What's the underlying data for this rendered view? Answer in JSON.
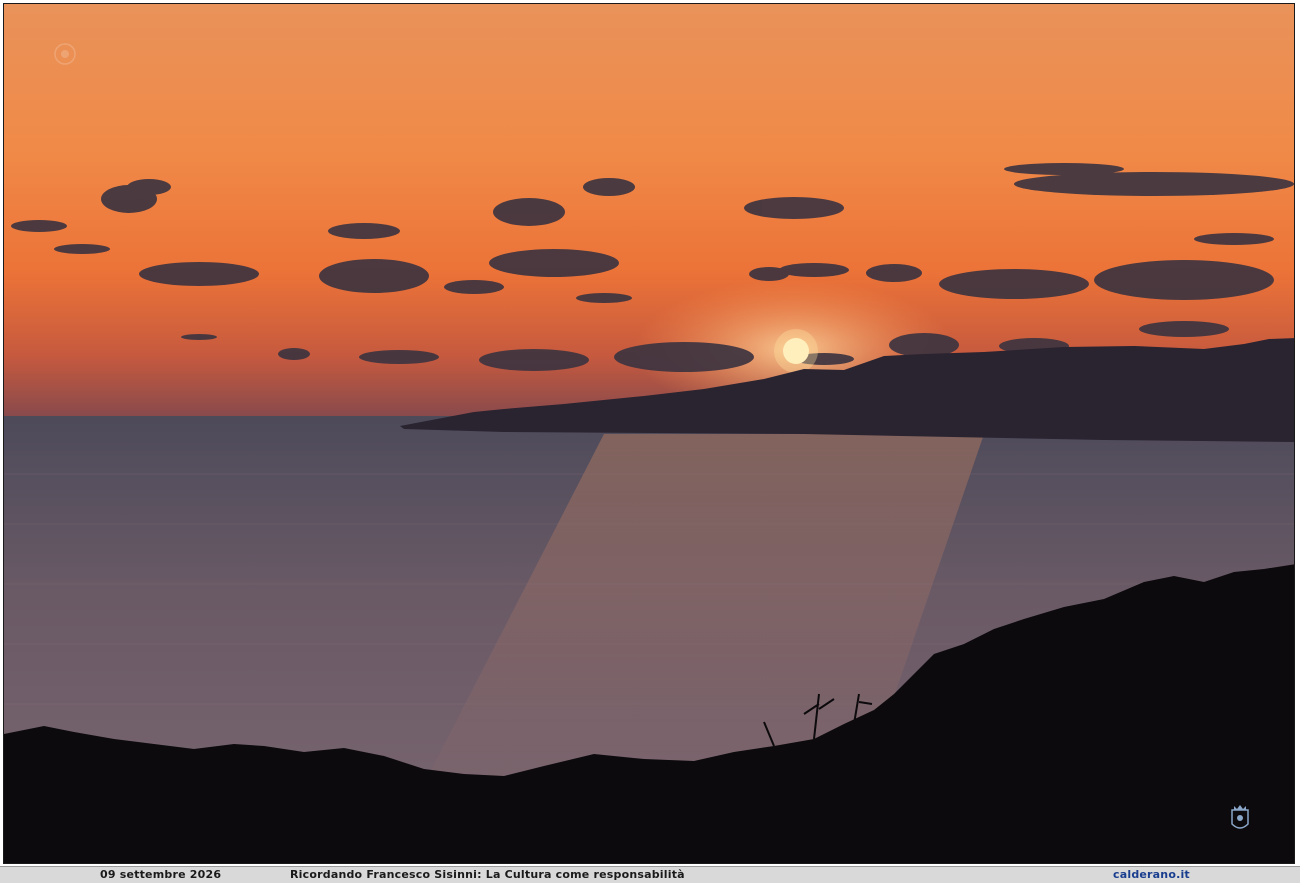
{
  "caption": {
    "date": "09 settembre 2026",
    "title": "Ricordando Francesco Sisinni: La Cultura come responsabilità",
    "site": "calderano.it"
  },
  "photo": {
    "subject": "sunset-over-sea",
    "colors": {
      "sky_top": "#e08a4a",
      "sky_mid": "#ef7a3a",
      "sky_low": "#d8623a",
      "horizon": "#8a4a4a",
      "sea": "#6a5a63",
      "sun": "#fff4c8",
      "silhouette": "#0c0a0c",
      "headland": "#2a2430"
    }
  },
  "logos": {
    "watermark_icon": "faint-seal-icon",
    "crest_icon": "crest-icon"
  }
}
